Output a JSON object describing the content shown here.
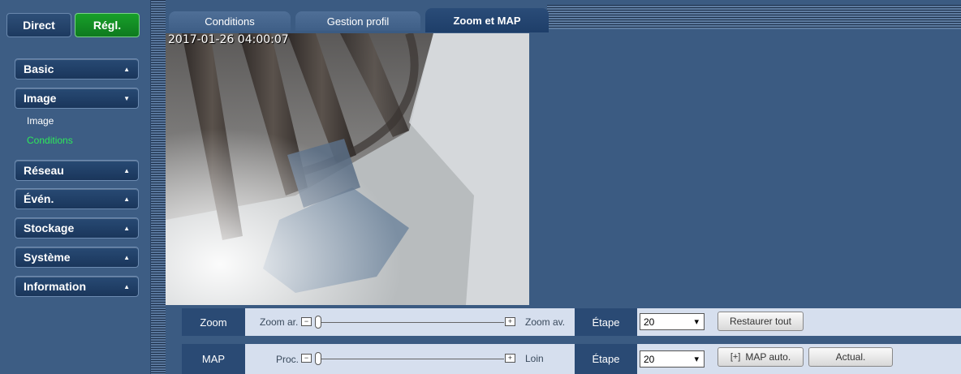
{
  "top_buttons": {
    "direct": "Direct",
    "regl": "Régl."
  },
  "menu": {
    "basic": "Basic",
    "image": "Image",
    "image_sub": "Image",
    "conditions_sub": "Conditions",
    "reseau": "Réseau",
    "even": "Évén.",
    "stockage": "Stockage",
    "systeme": "Système",
    "information": "Information"
  },
  "tabs": {
    "conditions": "Conditions",
    "gestion": "Gestion profil",
    "zoom_map": "Zoom et MAP"
  },
  "video": {
    "timestamp": "2017-01-26 04:00:07"
  },
  "zoom_row": {
    "label": "Zoom",
    "left_label": "Zoom ar.",
    "right_label": "Zoom av.",
    "step_label": "Étape",
    "step_value": "20",
    "restore_button": "Restaurer tout",
    "slider_level": 0
  },
  "map_row": {
    "label": "MAP",
    "left_label": "Proc.",
    "right_label": "Loin",
    "step_label": "Étape",
    "step_value": "20",
    "auto_button": "MAP auto.",
    "refresh_button": "Actual.",
    "slider_level": 0
  },
  "colors": {
    "background": "#3b5b82",
    "active_green": "#18a02a",
    "active_subitem": "#2ee85a"
  }
}
